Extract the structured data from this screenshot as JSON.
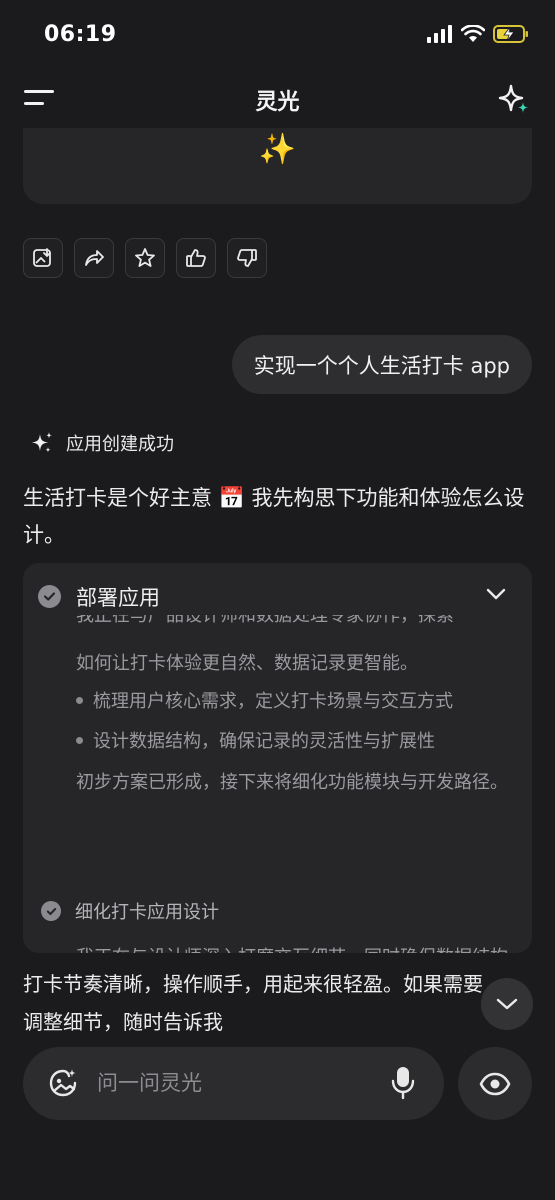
{
  "status_bar": {
    "time": "06:19",
    "icons": [
      "signal-icon",
      "wifi-icon",
      "battery-charging-icon"
    ]
  },
  "nav": {
    "title": "灵光",
    "menu_icon": "menu-icon",
    "action_icon": "sparkle-star-icon"
  },
  "previous_card": {
    "emoji": "✨"
  },
  "action_icons": [
    "save-image-icon",
    "share-icon",
    "star-icon",
    "thumbs-up-icon",
    "thumbs-down-icon"
  ],
  "user_message": "实现一个个人生活打卡 app",
  "status_line": {
    "icon": "sparkles-icon",
    "text": "应用创建成功"
  },
  "ai_message": "生活打卡是个好主意 📅 我先构思下功能和体验怎么设计。",
  "deploy": {
    "title": "部署应用",
    "cut_line": "我正在与产品设计师和数据处理专家协作，探索",
    "line1": "如何让打卡体验更自然、数据记录更智能。",
    "bullets": [
      "梳理用户核心需求，定义打卡场景与交互方式",
      "设计数据结构，确保记录的灵活性与扩展性"
    ],
    "summary": "初步方案已形成，接下来将细化功能模块与开发路径。",
    "sub_step_title": "细化打卡应用设计",
    "sub_step_desc": "我正在与设计师深入打磨交互细节，同时确保数据结构能灵活支持多种打卡场景。"
  },
  "final_message": "打卡节奏清晰，操作顺手，用起来很轻盈。如果需要调整细节，随时告诉我",
  "composer": {
    "placeholder": "问一问灵光"
  },
  "colors": {
    "background": "#1b1b1d",
    "card": "#262629",
    "bubble": "#2e2e31",
    "accent": "#3ad6b5"
  }
}
